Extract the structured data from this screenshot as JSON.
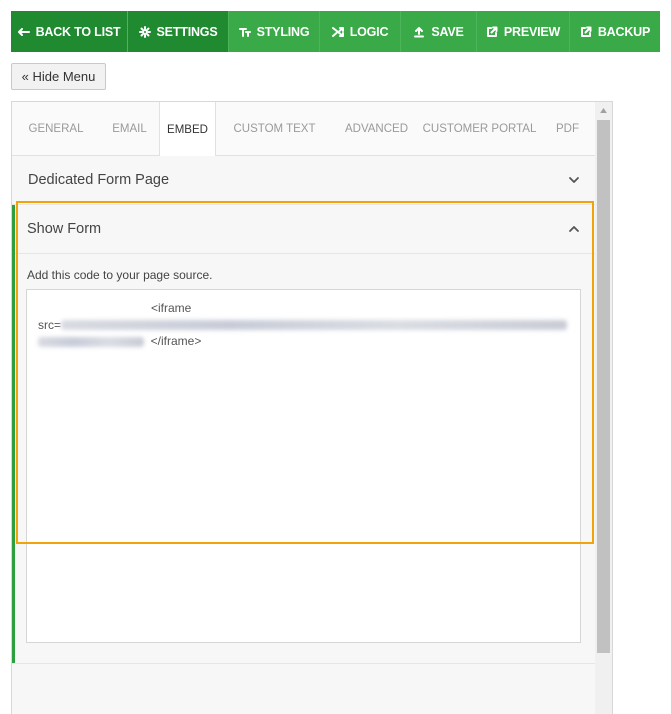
{
  "toolbar": {
    "buttons": [
      {
        "label": "Back To List",
        "icon": "back-arrow-icon"
      },
      {
        "label": "Settings",
        "icon": "gear-icon"
      },
      {
        "label": "Styling",
        "icon": "text-style-icon"
      },
      {
        "label": "Logic",
        "icon": "shuffle-icon"
      },
      {
        "label": "Save",
        "icon": "upload-icon"
      },
      {
        "label": "Preview",
        "icon": "external-link-icon"
      },
      {
        "label": "Backup",
        "icon": "external-link-icon"
      }
    ],
    "colors": {
      "base": "#2e9f3e",
      "active": "#1f8a30"
    }
  },
  "hide_menu": {
    "label": "« Hide Menu"
  },
  "tabs": [
    {
      "label": "General"
    },
    {
      "label": "Email"
    },
    {
      "label": "Embed",
      "active": true
    },
    {
      "label": "Custom Text"
    },
    {
      "label": "Advanced"
    },
    {
      "label": "Customer Portal"
    },
    {
      "label": "PDF"
    }
  ],
  "sections": {
    "dedicated": {
      "title": "Dedicated Form Page",
      "expanded": false
    },
    "show_form": {
      "title": "Show Form",
      "expanded": true,
      "hint": "Add this code to your page source.",
      "code_open": "<iframe",
      "code_src": "src=",
      "code_close": "</iframe>"
    }
  },
  "highlight_color": "#f0a30a"
}
